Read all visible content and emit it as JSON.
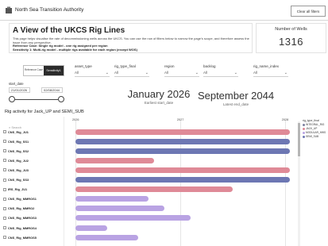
{
  "header": {
    "org_name": "North Sea Transition Authority",
    "clear_filters_label": "Clear all filters"
  },
  "hero": {
    "title": "A View of the UKCS Rig Lines",
    "description": "This page helps visualise the rate of decommissioning wells across the UKCS. You can use the row of filters below to narrow the page's scope, and therefore assess the issue from any perspective.",
    "reference_case": "Reference Case: Single rig model - one rig assigned per region",
    "sensitivity": "Sensitivity 1: Multi-rig model - multiple rigs available for each region (except WOS)"
  },
  "kpi": {
    "label": "Number of Wells",
    "value": "1316"
  },
  "scenario_toggle": {
    "off_label": "Reference Case",
    "on_label": "Sensitivity1"
  },
  "filters": [
    {
      "label": "asset_type",
      "value": "All"
    },
    {
      "label": "rig_type_final",
      "value": "All"
    },
    {
      "label": "region",
      "value": "All"
    },
    {
      "label": "backlog",
      "value": "All"
    },
    {
      "label": "rig_name_index",
      "value": "All"
    }
  ],
  "date_range": {
    "label": "start_date",
    "start": "21/01/2026",
    "end": "02/08/2044"
  },
  "earliest": {
    "value": "January 2026",
    "label": "Earliest start_date"
  },
  "latest": {
    "value": "September 2044",
    "label": "Latest end_date"
  },
  "chart": {
    "title": "Rig activity for Jack_UP and SEMI_SUB",
    "search_placeholder": "Search",
    "ticks": [
      "2026",
      "2027",
      "2028"
    ]
  },
  "chart_data": {
    "type": "bar",
    "orientation": "horizontal-gantt",
    "categories": [
      "CNS_Rig_JU1",
      "CNS_Rig_SS1",
      "CNS_Rig_SS2",
      "CNS_Rig_JU2",
      "CNS_Rig_JU3",
      "CNS_Rig_SS3",
      "IRS_Rig_JU1",
      "CNS_Rig_MMROS1",
      "CNS_Rig_MMRO2",
      "CNS_Rig_MMROS3",
      "CNS_Rig_MMROS4",
      "CNS_Rig_MMROS5"
    ],
    "series": [
      {
        "name": "INTEGRAL_RIG",
        "color": "#7b7f9e"
      },
      {
        "name": "JACK_UP",
        "color": "#df8a97"
      },
      {
        "name": "MODULAR_HWS",
        "color": "#b9a3e3"
      },
      {
        "name": "SEMI_SUB",
        "color": "#6d77b3"
      }
    ],
    "bars": [
      {
        "row": "CNS_Rig_JU1",
        "series": "JACK_UP",
        "start": 2026.0,
        "end": 2028.05
      },
      {
        "row": "CNS_Rig_SS1",
        "series": "SEMI_SUB",
        "start": 2026.0,
        "end": 2028.05
      },
      {
        "row": "CNS_Rig_SS2",
        "series": "SEMI_SUB",
        "start": 2026.0,
        "end": 2028.05
      },
      {
        "row": "CNS_Rig_JU2",
        "series": "JACK_UP",
        "start": 2026.0,
        "end": 2026.75
      },
      {
        "row": "CNS_Rig_JU3",
        "series": "JACK_UP",
        "start": 2026.0,
        "end": 2028.05
      },
      {
        "row": "CNS_Rig_SS3",
        "series": "SEMI_SUB",
        "start": 2026.0,
        "end": 2028.05
      },
      {
        "row": "IRS_Rig_JU1",
        "series": "JACK_UP",
        "start": 2026.0,
        "end": 2027.5
      },
      {
        "row": "CNS_Rig_MMROS1",
        "series": "MODULAR_HWS",
        "start": 2026.0,
        "end": 2026.7
      },
      {
        "row": "CNS_Rig_MMRO2",
        "series": "MODULAR_HWS",
        "start": 2026.0,
        "end": 2026.85
      },
      {
        "row": "CNS_Rig_MMROS3",
        "series": "MODULAR_HWS",
        "start": 2026.0,
        "end": 2027.1
      },
      {
        "row": "CNS_Rig_MMROS4",
        "series": "MODULAR_HWS",
        "start": 2026.0,
        "end": 2026.3
      },
      {
        "row": "CNS_Rig_MMROS5",
        "series": "MODULAR_HWS",
        "start": 2026.0,
        "end": 2026.6
      }
    ],
    "xlim": [
      2026,
      2028.1
    ],
    "legend_title": "rig_type_final",
    "legend_position": "right"
  }
}
